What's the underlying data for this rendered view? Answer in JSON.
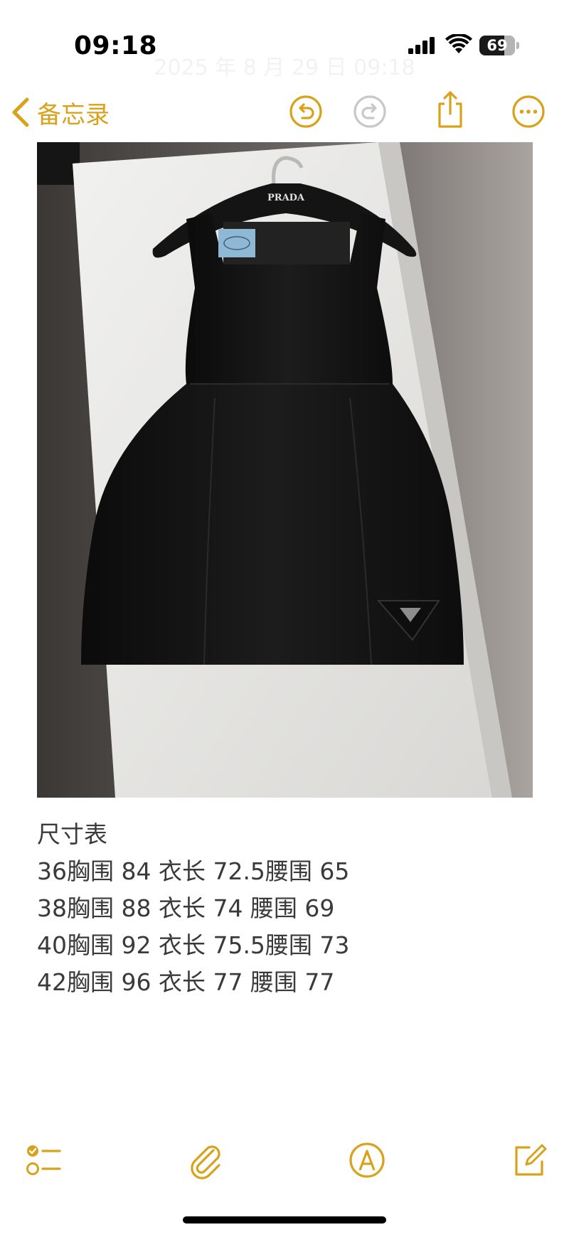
{
  "status_bar": {
    "time": "09:18",
    "note_date": "2025 年 8 月 29 日 09:18",
    "battery_level": 69,
    "battery_text": "69",
    "signal_bars": 4,
    "icons": [
      "cellular-signal-icon",
      "wifi-icon",
      "battery-icon"
    ]
  },
  "nav": {
    "back_label": "备忘录",
    "icons": [
      "chevron-left-icon",
      "undo-icon",
      "redo-icon",
      "share-icon",
      "more-icon"
    ],
    "redo_enabled": false
  },
  "content": {
    "photo_description_icon": "dress-photo",
    "photo_brand_text": "PRADA",
    "lines": [
      "尺寸表",
      "36胸围 84 衣长 72.5腰围 65",
      "38胸围 88 衣长 74 腰围 69",
      "40胸围 92 衣长 75.5腰围 73",
      "42胸围 96 衣长 77 腰围 77"
    ]
  },
  "toolbar": {
    "icons": [
      "checklist-icon",
      "paperclip-icon",
      "markup-pen-icon",
      "compose-icon"
    ]
  },
  "colors": {
    "accent": "#d9a21b",
    "disabled": "#c8c8c8",
    "text": "#3a3a3a"
  }
}
